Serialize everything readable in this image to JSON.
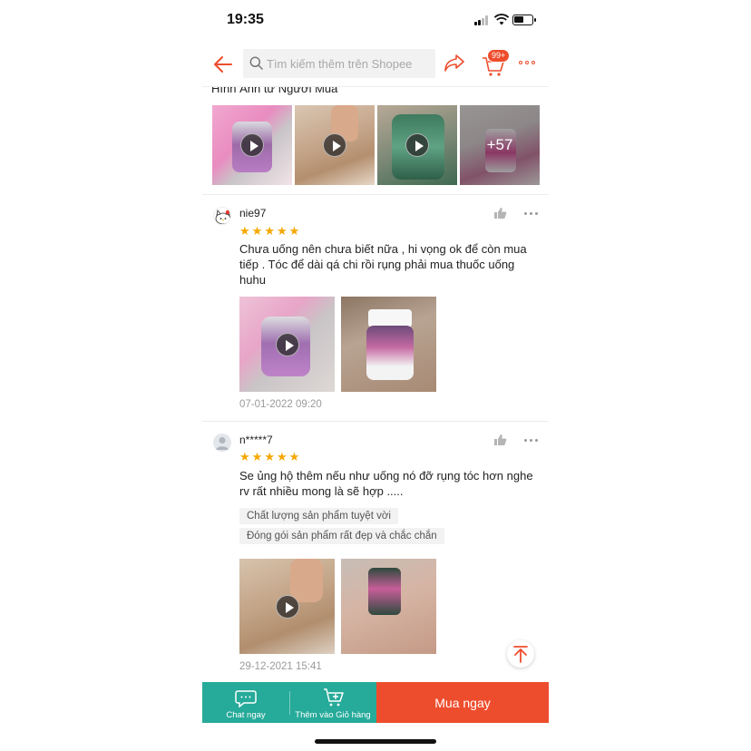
{
  "status_bar": {
    "time": "19:35"
  },
  "header": {
    "search_placeholder": "Tìm kiếm thêm trên Shopee",
    "cart_badge": "99+"
  },
  "media_section": {
    "title": "Hình Ảnh từ Người Mua",
    "more_count": "+57"
  },
  "reviews": [
    {
      "username": "nie97",
      "rating": 5,
      "text": "Chưa uống nên chưa biết nữa , hi vọng ok để còn mua tiếp . Tóc để dài qá chi rồi rụng phải mua thuốc uống huhu",
      "date": "07-01-2022 09:20"
    },
    {
      "username": "n*****7",
      "rating": 5,
      "text": "Se ủng hộ thêm nếu như uống nó đỡ rụng tóc hơn nghe rv rất nhiều mong là sẽ hợp .....",
      "tags": [
        "Chất lượng sản phẩm tuyệt vời",
        "Đóng gói sản phẩm rất đẹp và chắc chắn"
      ],
      "date": "29-12-2021 15:41"
    }
  ],
  "bottom_bar": {
    "chat_label": "Chat ngay",
    "add_to_cart_label": "Thêm vào Giỏ hàng",
    "buy_now_label": "Mua ngay"
  },
  "colors": {
    "brand": "#ee4d2d",
    "teal": "#26aa99",
    "star": "#f6a700"
  }
}
